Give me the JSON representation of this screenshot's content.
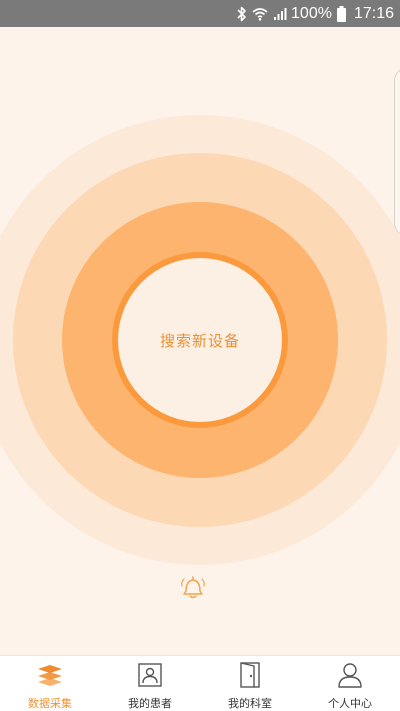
{
  "status_bar": {
    "battery_text": "100%",
    "time": "17:16",
    "icons": [
      "bluetooth-icon",
      "wifi-icon",
      "signal-icon",
      "battery-icon"
    ]
  },
  "main": {
    "search_button_label": "搜索新设备",
    "bell_icon": "bell-icon"
  },
  "tabs": [
    {
      "label": "数据采集",
      "icon": "layers-icon",
      "active": true
    },
    {
      "label": "我的患者",
      "icon": "patient-card-icon",
      "active": false
    },
    {
      "label": "我的科室",
      "icon": "door-icon",
      "active": false
    },
    {
      "label": "个人中心",
      "icon": "user-icon",
      "active": false
    }
  ],
  "colors": {
    "accent": "#f29331",
    "ring_outer": "#fce9d8",
    "ring_mid": "#fdd8b5",
    "ring_inner": "#fdb46e",
    "ring_border": "#fb9a3c",
    "status_bar": "#7a7a7a",
    "background": "#fdf3ea"
  }
}
